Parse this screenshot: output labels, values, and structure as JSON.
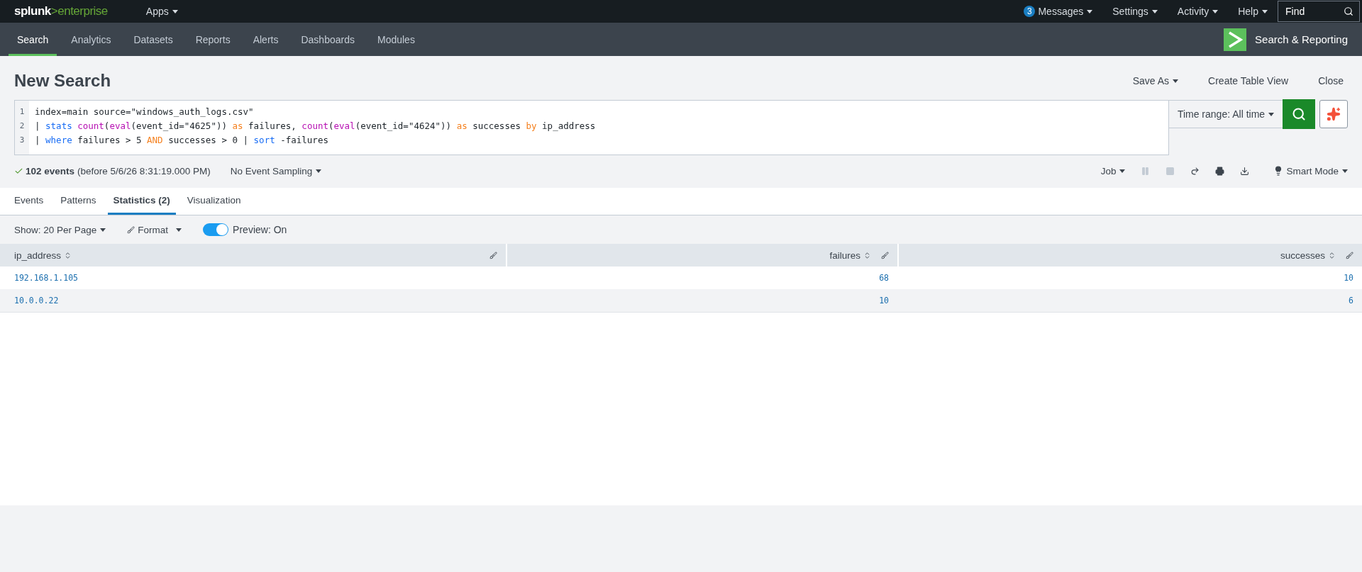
{
  "top_bar": {
    "logo": {
      "text": "splunk",
      "accent": ">enterprise"
    },
    "apps_menu": {
      "label": "Apps",
      "dropdown": true
    },
    "menus": [
      {
        "label": "Messages",
        "badge": "3",
        "dropdown": true
      },
      {
        "label": "Settings",
        "dropdown": true
      },
      {
        "label": "Activity",
        "dropdown": true
      },
      {
        "label": "Help",
        "dropdown": true
      }
    ],
    "find": {
      "placeholder": "Find"
    }
  },
  "app_bar": {
    "tabs": [
      {
        "label": "Search",
        "selected": true
      },
      {
        "label": "Analytics",
        "selected": false
      },
      {
        "label": "Datasets",
        "selected": false
      },
      {
        "label": "Reports",
        "selected": false
      },
      {
        "label": "Alerts",
        "selected": false
      },
      {
        "label": "Dashboards",
        "selected": false
      },
      {
        "label": "Modules",
        "selected": false
      }
    ],
    "app_title": "Search & Reporting"
  },
  "page": {
    "title": "New Search",
    "actions": [
      {
        "label": "Save As",
        "dropdown": true
      },
      {
        "label": "Create Table View",
        "dropdown": false
      },
      {
        "label": "Close",
        "dropdown": false
      }
    ]
  },
  "query": {
    "lines": [
      {
        "number": "1",
        "tokens": [
          {
            "text": "index=main source=\"windows_auth_logs.csv\"",
            "kind": "plain"
          }
        ]
      },
      {
        "number": "2",
        "tokens": [
          {
            "text": "| ",
            "kind": "plain"
          },
          {
            "text": "stats ",
            "kind": "command"
          },
          {
            "text": "count",
            "kind": "function"
          },
          {
            "text": "(",
            "kind": "plain"
          },
          {
            "text": "eval",
            "kind": "function"
          },
          {
            "text": "(event_id=\"4625\")) ",
            "kind": "plain"
          },
          {
            "text": "as",
            "kind": "keyword"
          },
          {
            "text": " failures, ",
            "kind": "plain"
          },
          {
            "text": "count",
            "kind": "function"
          },
          {
            "text": "(",
            "kind": "plain"
          },
          {
            "text": "eval",
            "kind": "function"
          },
          {
            "text": "(event_id=\"4624\")) ",
            "kind": "plain"
          },
          {
            "text": "as",
            "kind": "keyword"
          },
          {
            "text": " successes ",
            "kind": "plain"
          },
          {
            "text": "by",
            "kind": "keyword"
          },
          {
            "text": " ip_address",
            "kind": "plain"
          }
        ]
      },
      {
        "number": "3",
        "tokens": [
          {
            "text": "| ",
            "kind": "plain"
          },
          {
            "text": "where",
            "kind": "command"
          },
          {
            "text": " failures > 5 ",
            "kind": "plain"
          },
          {
            "text": "AND",
            "kind": "keyword"
          },
          {
            "text": " successes > 0 | ",
            "kind": "plain"
          },
          {
            "text": "sort",
            "kind": "command"
          },
          {
            "text": " -failures",
            "kind": "plain"
          }
        ]
      }
    ],
    "time_range": "Time range: All time"
  },
  "status": {
    "count": "102 events",
    "detail": "(before 5/6/26 8:31:19.000 PM)",
    "sampling": "No Event Sampling",
    "job": "Job",
    "job_controls": [
      {
        "kind": "pause",
        "disabled": true
      },
      {
        "kind": "stop",
        "disabled": true
      },
      {
        "kind": "share",
        "disabled": false
      },
      {
        "kind": "print",
        "disabled": false
      },
      {
        "kind": "export",
        "disabled": false
      }
    ],
    "mode": "Smart Mode"
  },
  "result_tabs": [
    {
      "label": "Events",
      "selected": false
    },
    {
      "label": "Patterns",
      "selected": false
    },
    {
      "label": "Statistics (2)",
      "selected": true
    },
    {
      "label": "Visualization",
      "selected": false
    }
  ],
  "toolbar": {
    "page_size": "Show: 20 Per Page",
    "format": "Format",
    "preview": {
      "on": true,
      "label": "Preview: On"
    }
  },
  "table": {
    "columns": [
      {
        "label": "ip_address",
        "kind": "text"
      },
      {
        "label": "failures",
        "kind": "number"
      },
      {
        "label": "successes",
        "kind": "number"
      }
    ],
    "rows": [
      [
        "192.168.1.105",
        "68",
        "10"
      ],
      [
        "10.0.0.22",
        "10",
        "6"
      ]
    ]
  }
}
